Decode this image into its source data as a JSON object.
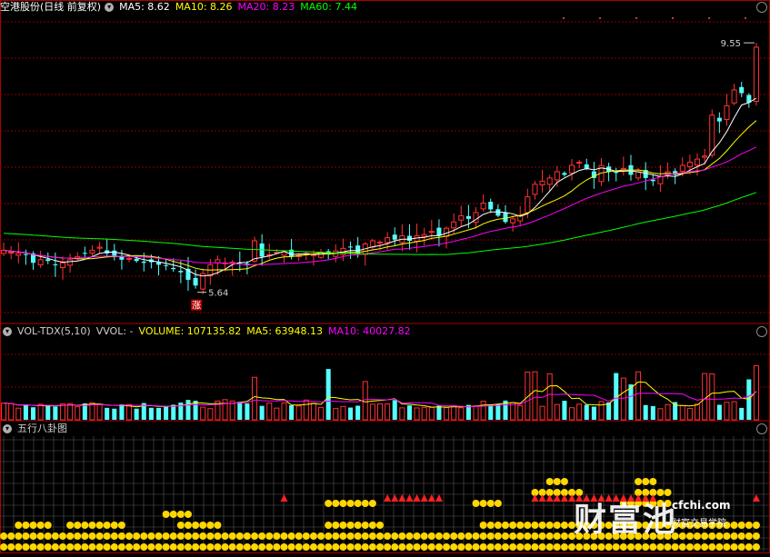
{
  "header": {
    "stock_name": "空港股份",
    "period": "(日线 前复权)",
    "ma_items": [
      {
        "label": "MA5: 8.62",
        "color": "#ffffff"
      },
      {
        "label": "MA10: 8.26",
        "color": "#ffff00"
      },
      {
        "label": "MA20: 8.23",
        "color": "#ff00ff"
      },
      {
        "label": "MA60: 7.44",
        "color": "#00ff00"
      }
    ]
  },
  "price_panel": {
    "high_marker": "9.55",
    "low_marker": "5.64",
    "low_tag": "涨"
  },
  "volume_panel": {
    "name": "VOL-TDX(5,10)",
    "vvol": "VVOL: -",
    "volume": "VOLUME: 107135.82",
    "ma5": "MA5: 63948.13",
    "ma10": "MA10: 40027.82"
  },
  "signal_panel": {
    "name": "五行八卦图"
  },
  "watermark": {
    "brand": "财富池",
    "url": "cfchi.com",
    "tagline": "财富交易学院"
  },
  "colors": {
    "up": "#ff3232",
    "down": "#54ffff",
    "ma5": "#ffffff",
    "ma10": "#ffff00",
    "ma20": "#ff00ff",
    "ma60": "#00ff00",
    "grid": "#8b0000",
    "frame": "#b00000",
    "dot": "#ffd700",
    "tri": "#ff2020"
  },
  "chart_data": [
    {
      "type": "candlestick",
      "title": "空港股份 (日线 前复权)",
      "ylim": [
        5.1,
        10.0
      ],
      "x_count": 103,
      "closes": [
        6.25,
        6.22,
        6.2,
        6.18,
        6.05,
        6.1,
        6.08,
        6.02,
        6.05,
        6.1,
        6.15,
        6.2,
        6.25,
        6.3,
        6.2,
        6.15,
        6.1,
        6.12,
        6.08,
        6.05,
        6.06,
        6.02,
        6.0,
        5.95,
        5.9,
        5.78,
        5.69,
        5.88,
        6.02,
        6.1,
        6.05,
        6.06,
        6.04,
        6.03,
        6.4,
        6.15,
        6.18,
        6.22,
        6.22,
        6.15,
        6.18,
        6.2,
        6.18,
        6.22,
        6.2,
        6.24,
        6.28,
        6.3,
        6.2,
        6.35,
        6.4,
        6.38,
        6.45,
        6.42,
        6.48,
        6.4,
        6.48,
        6.5,
        6.55,
        6.48,
        6.6,
        6.7,
        6.8,
        6.75,
        6.85,
        7.0,
        6.9,
        6.8,
        6.7,
        6.75,
        6.8,
        7.1,
        7.3,
        7.35,
        7.4,
        7.5,
        7.45,
        7.6,
        7.65,
        7.55,
        7.4,
        7.6,
        7.5,
        7.48,
        7.55,
        7.45,
        7.5,
        7.4,
        7.35,
        7.42,
        7.5,
        7.45,
        7.6,
        7.65,
        7.7,
        7.75,
        8.4,
        8.3,
        8.55,
        8.8,
        8.75,
        8.6,
        8.65
      ]
    },
    {
      "type": "bar",
      "title": "VOL-TDX(5,10)",
      "series": [
        {
          "name": "VOLUME",
          "values": [
            107135.82
          ]
        },
        {
          "name": "MA5",
          "values": [
            63948.13
          ]
        },
        {
          "name": "MA10",
          "values": [
            40027.82
          ]
        }
      ]
    },
    {
      "type": "other",
      "title": "五行八卦图",
      "dot_rows_by_bar": [
        2,
        2,
        3,
        3,
        3,
        3,
        3,
        2,
        2,
        3,
        3,
        3,
        3,
        3,
        3,
        3,
        3,
        2,
        2,
        2,
        2,
        2,
        2,
        2,
        3,
        3,
        3,
        3,
        3,
        3,
        2,
        2,
        2,
        2,
        2,
        2,
        2,
        2,
        2,
        2,
        2,
        2,
        2,
        2,
        3,
        3,
        3,
        3,
        3,
        3,
        3,
        3,
        2,
        2,
        2,
        2,
        2,
        2,
        2,
        2,
        2,
        2,
        2,
        2,
        2,
        3,
        3,
        3,
        3,
        3,
        3,
        3,
        3,
        3,
        3,
        3,
        3,
        3,
        3,
        3,
        3,
        3,
        3,
        3,
        3,
        3,
        3,
        3,
        3,
        3,
        3,
        3,
        3,
        3,
        3,
        3,
        3,
        3,
        3,
        3,
        3,
        3,
        3
      ],
      "triangle_bars": [
        38,
        52,
        53,
        54,
        55,
        56,
        57,
        58,
        59,
        72,
        73,
        74,
        75,
        76,
        77,
        78,
        79,
        80,
        81,
        82,
        83,
        84,
        85,
        86,
        87,
        88,
        102
      ]
    }
  ]
}
